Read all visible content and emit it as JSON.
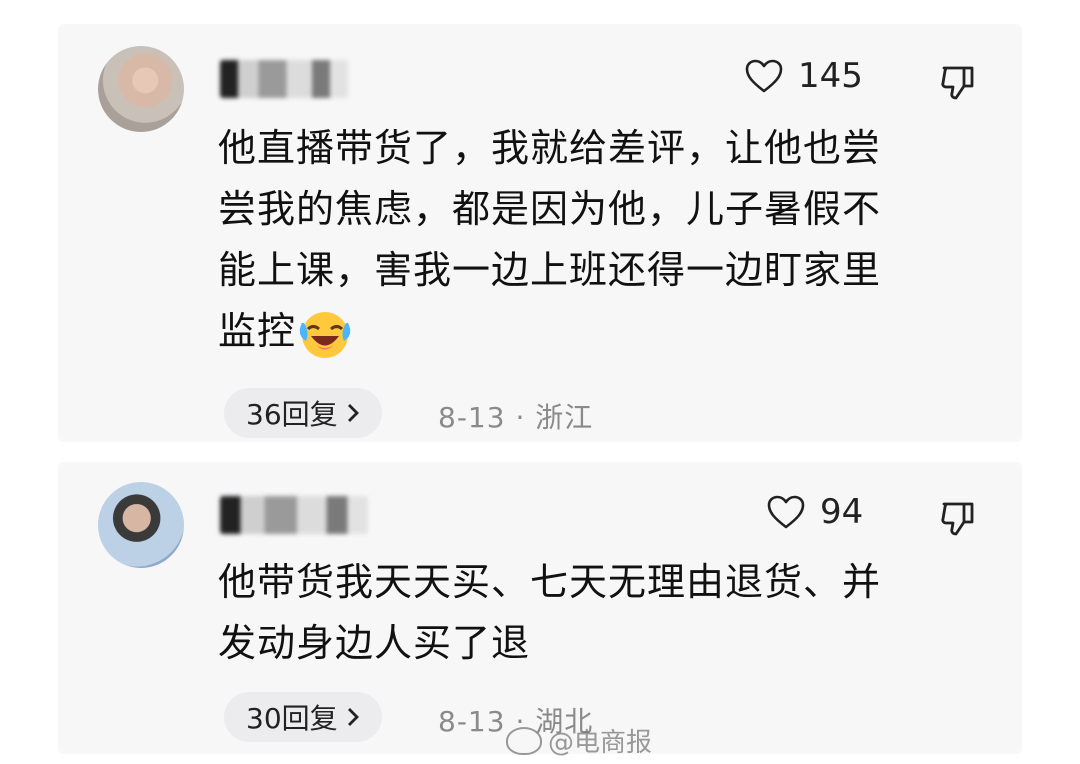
{
  "comments": [
    {
      "likes": "145",
      "text_lines": [
        "他直播带货了，我就给差评，让他也尝",
        "尝我的焦虑，都是因为他，儿子暑假不",
        "能上课，害我一边上班还得一边盯家里",
        "监控"
      ],
      "emoji": "laughing-crying-emoji",
      "replies_label": "36回复",
      "meta": "8-13 · 浙江"
    },
    {
      "likes": "94",
      "text_lines": [
        "他带货我天天买、七天无理由退货、并",
        "发动身边人买了退"
      ],
      "replies_label": "30回复",
      "meta": "8-13 · 湖北"
    }
  ],
  "watermark": "@电商报",
  "colors": {
    "card_bg": "#f7f7f8",
    "text": "#111111",
    "meta": "#8a8a8a",
    "pill": "#ececee"
  }
}
